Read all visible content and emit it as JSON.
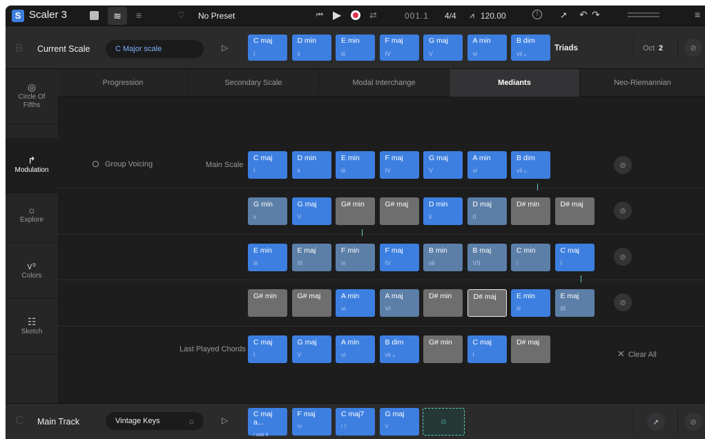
{
  "app": {
    "logo_letter": "S",
    "name": "Scaler 3"
  },
  "toolbar": {
    "preset": "No Preset",
    "position": "001.1",
    "time_signature": "4/4",
    "tempo": "120.00"
  },
  "current_scale": {
    "letter": "B",
    "label": "Current Scale",
    "scale_name": "C Major scale",
    "chords": [
      {
        "name": "C maj",
        "roman": "I"
      },
      {
        "name": "D min",
        "roman": "ii"
      },
      {
        "name": "E min",
        "roman": "iii"
      },
      {
        "name": "F maj",
        "roman": "IV"
      },
      {
        "name": "G maj",
        "roman": "V"
      },
      {
        "name": "A min",
        "roman": "vi"
      },
      {
        "name": "B dim",
        "roman": "vii ₒ"
      }
    ],
    "chord_type": "Triads",
    "octave_label": "Oct",
    "octave_value": "2"
  },
  "sidebar": {
    "items": [
      {
        "label": "Circle Of Fifths",
        "icon": "circle-of-fifths-icon"
      },
      {
        "label": "Modulation",
        "icon": "modulation-icon"
      },
      {
        "label": "Explore",
        "icon": "bulb-icon"
      },
      {
        "label": "Colors",
        "icon": "colors-icon"
      },
      {
        "label": "Sketch",
        "icon": "sketch-icon"
      }
    ],
    "active": "Modulation"
  },
  "tabs": [
    {
      "label": "Progression"
    },
    {
      "label": "Secondary Scale"
    },
    {
      "label": "Modal Interchange"
    },
    {
      "label": "Mediants"
    },
    {
      "label": "Neo-Riemannian"
    }
  ],
  "active_tab": "Mediants",
  "modulation": {
    "group_voicing": "Group Voicing",
    "main_scale_label": "Main Scale",
    "main_scale": [
      {
        "name": "C maj",
        "roman": "I",
        "color": "blue"
      },
      {
        "name": "D min",
        "roman": "ii",
        "color": "blue"
      },
      {
        "name": "E min",
        "roman": "iii",
        "color": "blue"
      },
      {
        "name": "F maj",
        "roman": "IV",
        "color": "blue"
      },
      {
        "name": "G maj",
        "roman": "V",
        "color": "blue"
      },
      {
        "name": "A min",
        "roman": "vi",
        "color": "blue"
      },
      {
        "name": "B dim",
        "roman": "vii ₒ",
        "color": "blue"
      }
    ],
    "rows": [
      [
        {
          "name": "G min",
          "roman": "v",
          "color": "slate"
        },
        {
          "name": "G maj",
          "roman": "V",
          "color": "blue"
        },
        {
          "name": "G# min",
          "roman": "",
          "color": "gray"
        },
        {
          "name": "G# maj",
          "roman": "",
          "color": "gray"
        },
        {
          "name": "D min",
          "roman": "ii",
          "color": "blue"
        },
        {
          "name": "D maj",
          "roman": "II",
          "color": "slate"
        },
        {
          "name": "D# min",
          "roman": "",
          "color": "gray"
        },
        {
          "name": "D# maj",
          "roman": "",
          "color": "gray"
        }
      ],
      [
        {
          "name": "E min",
          "roman": "iii",
          "color": "blue"
        },
        {
          "name": "E maj",
          "roman": "III",
          "color": "slate"
        },
        {
          "name": "F min",
          "roman": "iv",
          "color": "slate"
        },
        {
          "name": "F maj",
          "roman": "IV",
          "color": "blue"
        },
        {
          "name": "B min",
          "roman": "vii",
          "color": "slate"
        },
        {
          "name": "B maj",
          "roman": "VII",
          "color": "slate"
        },
        {
          "name": "C min",
          "roman": "i",
          "color": "slate"
        },
        {
          "name": "C maj",
          "roman": "I",
          "color": "blue"
        }
      ],
      [
        {
          "name": "G# min",
          "roman": "",
          "color": "gray"
        },
        {
          "name": "G# maj",
          "roman": "",
          "color": "gray"
        },
        {
          "name": "A min",
          "roman": "vi",
          "color": "blue"
        },
        {
          "name": "A maj",
          "roman": "VI",
          "color": "slate"
        },
        {
          "name": "D# min",
          "roman": "",
          "color": "gray"
        },
        {
          "name": "D# maj",
          "roman": "",
          "color": "gray",
          "selected": true
        },
        {
          "name": "E min",
          "roman": "iii",
          "color": "blue"
        },
        {
          "name": "E maj",
          "roman": "III",
          "color": "slate"
        }
      ]
    ],
    "last_played_label": "Last Played Chords",
    "last_played": [
      {
        "name": "C maj",
        "roman": "I",
        "color": "blue"
      },
      {
        "name": "G maj",
        "roman": "V",
        "color": "blue"
      },
      {
        "name": "A min",
        "roman": "vi",
        "color": "blue"
      },
      {
        "name": "B dim",
        "roman": "vii ₒ",
        "color": "blue"
      },
      {
        "name": "G# min",
        "roman": "",
        "color": "gray"
      },
      {
        "name": "C maj",
        "roman": "I",
        "color": "blue"
      },
      {
        "name": "D# maj",
        "roman": "",
        "color": "gray"
      }
    ],
    "clear_all": "Clear All"
  },
  "main_track": {
    "letter": "C",
    "label": "Main Track",
    "instrument": "Vintage Keys",
    "chords": [
      {
        "name": "C maj a...",
        "roman": "I add 9"
      },
      {
        "name": "F maj",
        "roman": "IV"
      },
      {
        "name": "C maj7",
        "roman": "I 7"
      },
      {
        "name": "G maj",
        "roman": "V"
      }
    ]
  },
  "colors": {
    "blue": "#3d7fe0",
    "slate": "#5c7fa8",
    "gray": "#6e6e6e",
    "accent_teal": "#5fd3c3"
  }
}
